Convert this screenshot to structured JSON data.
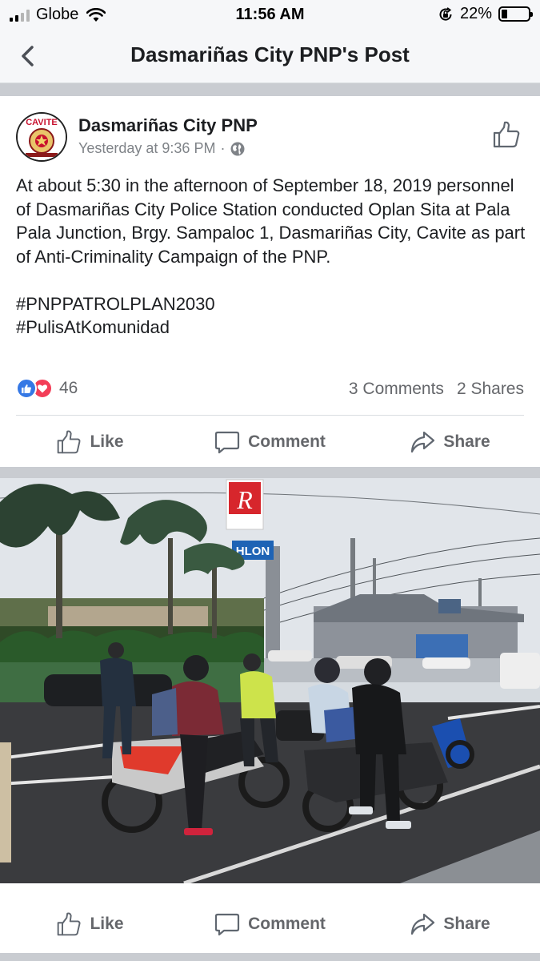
{
  "status_bar": {
    "carrier": "Globe",
    "time": "11:56 AM",
    "battery_percent": "22%",
    "battery_level": 0.22,
    "signal_bars": 2,
    "icons": [
      "signal-icon",
      "wifi-icon",
      "orientation-lock-icon",
      "battery-icon"
    ]
  },
  "nav": {
    "title": "Dasmariñas City PNP's Post",
    "back_icon": "chevron-left-icon"
  },
  "post": {
    "author": "Dasmariñas City PNP",
    "avatar_text": "CAVITE",
    "timestamp": "Yesterday at 9:36 PM",
    "separator": "·",
    "privacy_icon": "globe-icon",
    "text": "At about 5:30 in the afternoon of September 18, 2019 personnel of Dasmariñas City Police Station conducted Oplan Sita at Pala Pala Junction, Brgy. Sampaloc 1, Dasmariñas City, Cavite as part of Anti-Criminality Campaign of the PNP.\n\n#PNPPATROLPLAN2030\n#PulisAtKomunidad",
    "reaction_count": "46",
    "comments": "3 Comments",
    "shares": "2 Shares"
  },
  "actions": {
    "like": "Like",
    "comment": "Comment",
    "share": "Share"
  },
  "photo_sign": {
    "banner": "HLON",
    "billboard_letter": "R"
  },
  "colors": {
    "accent_blue": "#3578e5",
    "love_red": "#f33e58",
    "separator_gray": "#c9ccd1",
    "muted_text": "#65676b"
  }
}
